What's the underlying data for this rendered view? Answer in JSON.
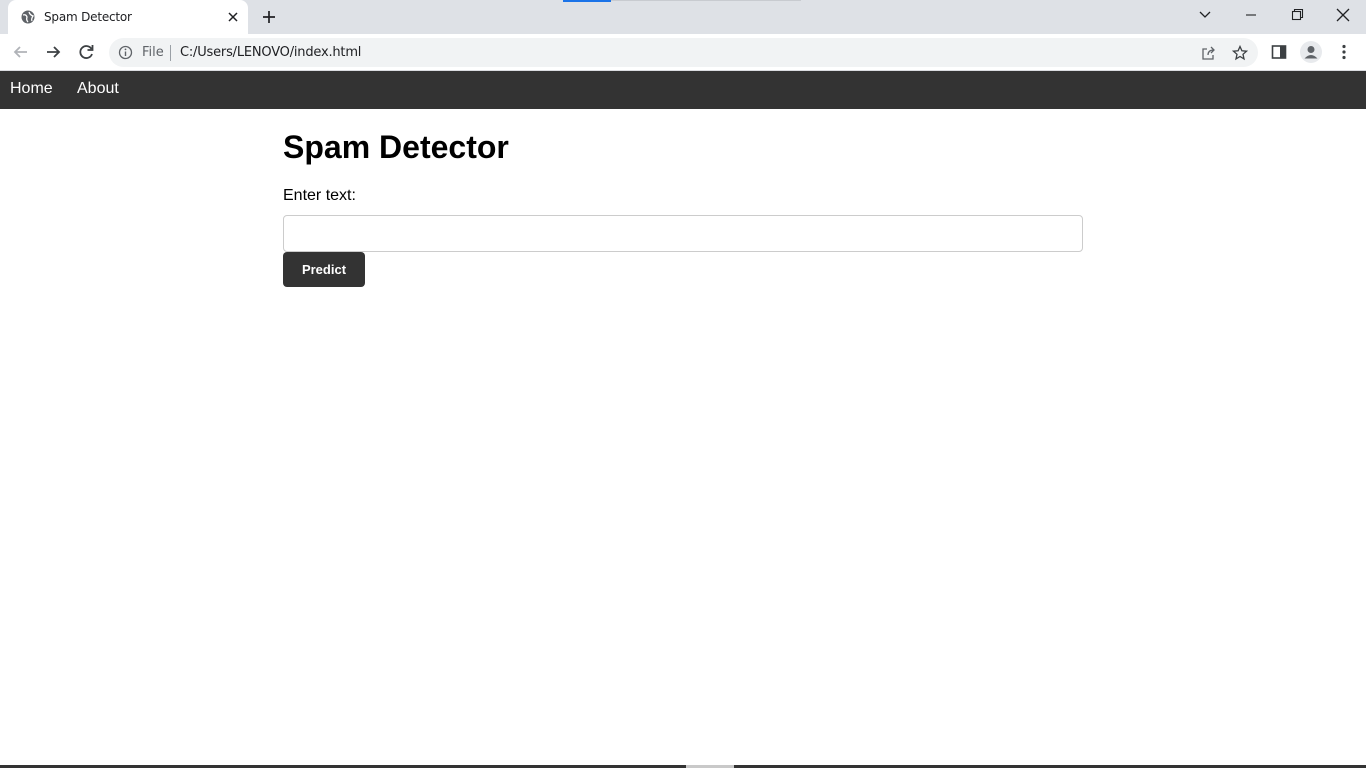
{
  "browser": {
    "tab": {
      "title": "Spam Detector"
    },
    "address": {
      "scheme_label": "File",
      "url": "C:/Users/LENOVO/index.html"
    },
    "icons": [
      "globe-icon",
      "close-icon",
      "plus-icon",
      "chevron-down-icon",
      "minimize-icon",
      "restore-icon",
      "close-window-icon",
      "back-arrow-icon",
      "forward-arrow-icon",
      "reload-icon",
      "info-icon",
      "share-icon",
      "star-icon",
      "side-panel-icon",
      "profile-icon",
      "kebab-menu-icon"
    ]
  },
  "page": {
    "nav": {
      "home_label": "Home",
      "about_label": "About"
    },
    "title": "Spam Detector",
    "input_label": "Enter text:",
    "input_value": "",
    "predict_label": "Predict",
    "colors": {
      "navbar": "#333333",
      "button": "#333333",
      "text": "#000000"
    }
  }
}
